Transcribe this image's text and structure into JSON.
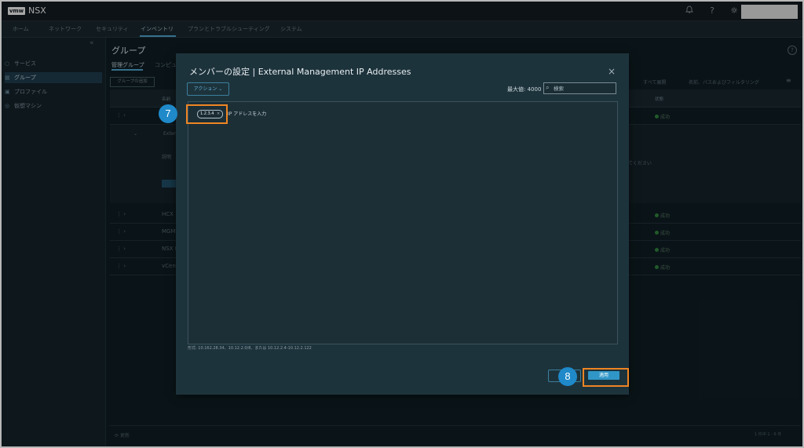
{
  "topbar": {
    "logo": "vmw",
    "product": "NSX",
    "bell_icon": "bell-icon",
    "help_icon": "help-circle-icon",
    "theme_icon": "sun-icon"
  },
  "nav": {
    "tabs": [
      "ホーム",
      "ネットワーク",
      "セキュリティ",
      "インベントリ",
      "プランとトラブルシューティング",
      "システム"
    ],
    "active": "インベントリ"
  },
  "sidebar": {
    "items": [
      "サービス",
      "グループ",
      "プロファイル",
      "仮想マシン"
    ],
    "active": "グループ"
  },
  "page": {
    "title": "グループ",
    "subtabs": [
      "管理グループ",
      "コンピュ"
    ],
    "add_group": "グループの追加",
    "expand_all": "すべて展開",
    "filter_text": "名前、パスおよびフィルタリング",
    "columns": [
      "名前",
      "状態"
    ],
    "rows": [
      "",
      "Exter",
      "HCX",
      "MGMT",
      "NSX M",
      "vCent"
    ],
    "status": "成功",
    "expanded_label": "説明",
    "expanded_hint": "てください",
    "refresh": "更新",
    "pagination": "1 件中 1 - 6 件"
  },
  "modal": {
    "title": "メンバーの設定 | External Management IP Addresses",
    "action_button": "アクション",
    "max_label": "最大値: 4000",
    "search_placeholder": "検索",
    "chip_value": "1.2.3.4",
    "input_placeholder": "IP アドレスを入力",
    "format_hint": "形式: 10.162.28.34、10.12.2.0/8、または 10.12.2.4-10.12.2.122",
    "apply_button": "適用",
    "close_symbol": "×"
  },
  "annotations": {
    "step_chip": "7",
    "step_apply": "8",
    "highlight_color": "#ee8523",
    "badge_color": "#1f89c9"
  }
}
